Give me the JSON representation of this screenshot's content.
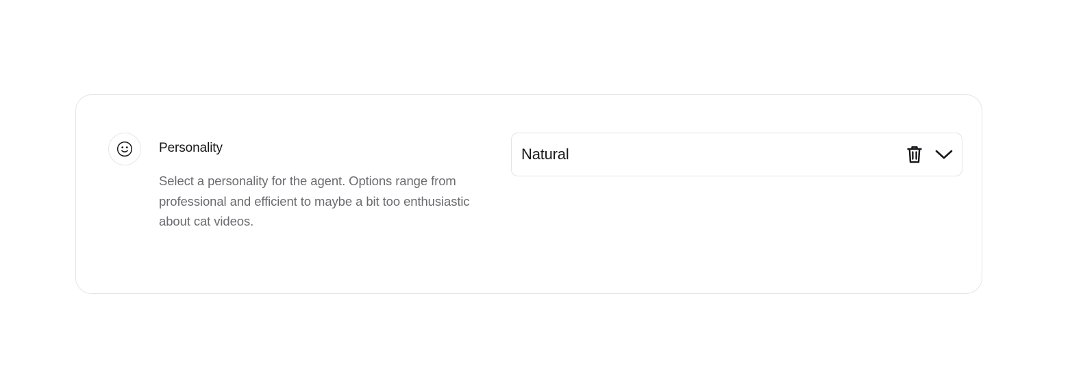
{
  "setting": {
    "icon": "smiley-face-icon",
    "title": "Personality",
    "description": "Select a personality for the agent. Options range from professional and efficient to maybe a bit too enthusiastic about cat videos."
  },
  "select": {
    "value": "Natural",
    "clear_icon": "trash-icon",
    "expand_icon": "chevron-down-icon"
  },
  "colors": {
    "text_primary": "#18181b",
    "text_secondary": "#6b6b70",
    "border": "#e4e4e7",
    "background": "#ffffff"
  }
}
